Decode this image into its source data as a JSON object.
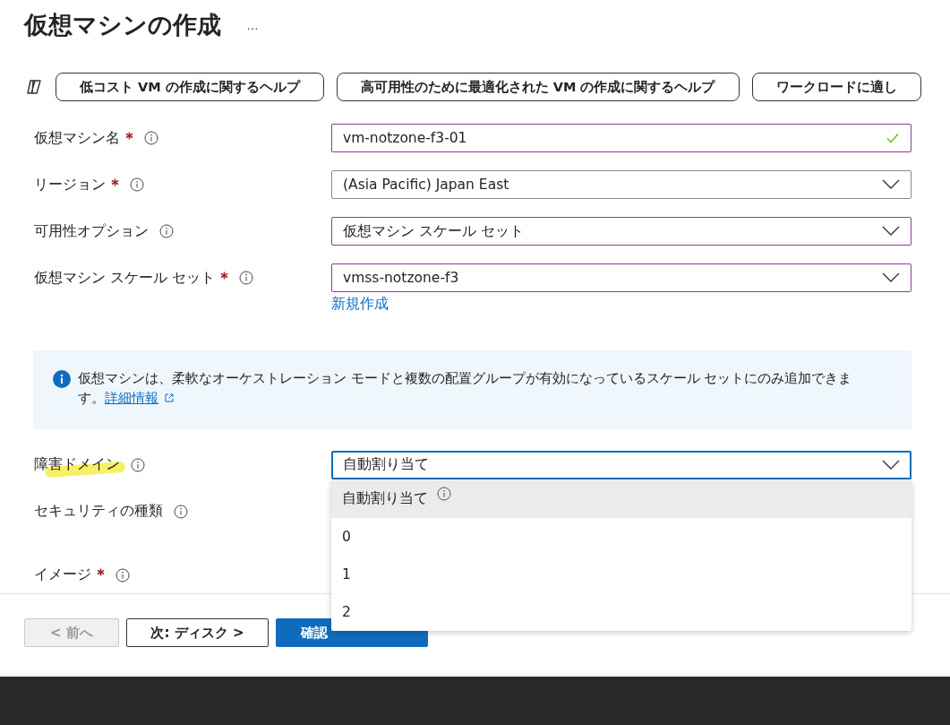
{
  "title": "仮想マシンの作成",
  "more": "…",
  "help_chips": [
    "低コスト VM の作成に関するヘルプ",
    "高可用性のために最適化された VM の作成に関するヘルプ",
    "ワークロードに適し"
  ],
  "rows": [
    {
      "kind": "text",
      "label": "仮想マシン名",
      "required": true,
      "value": "vm-notzone-f3-01",
      "valid": true
    },
    {
      "kind": "select",
      "label": "リージョン",
      "required": true,
      "value": "(Asia Pacific) Japan East"
    },
    {
      "kind": "select",
      "label": "可用性オプション",
      "required": false,
      "value": "仮想マシン スケール セット"
    },
    {
      "kind": "select",
      "label": "仮想マシン スケール セット",
      "required": true,
      "value": "vmss-notzone-f3",
      "link": "新規作成"
    },
    {
      "kind": "info",
      "text": "仮想マシンは、柔軟なオーケストレーション モードと複数の配置グループが有効になっているスケール セットにのみ追加できます。",
      "link": "詳細情報"
    },
    {
      "kind": "dropdown",
      "label": "障害ドメイン",
      "required": false,
      "highlighted": true,
      "value": "自動割り当て",
      "expanded": true,
      "options": [
        {
          "label": "自動割り当て",
          "info": true,
          "selected": true
        },
        {
          "label": "0",
          "info": false,
          "selected": false
        },
        {
          "label": "1",
          "info": false,
          "selected": false
        },
        {
          "label": "2",
          "info": false,
          "selected": false
        }
      ]
    },
    {
      "kind": "label",
      "label": "セキュリティの種類",
      "required": false
    },
    {
      "kind": "label",
      "label": "イメージ",
      "required": true
    }
  ],
  "footer": [
    {
      "label": "< 前へ",
      "kind": "secondary",
      "disabled": true
    },
    {
      "label": "次: ディスク >",
      "kind": "secondary",
      "disabled": false
    },
    {
      "label": "確認",
      "kind": "primary",
      "disabled": false
    }
  ]
}
